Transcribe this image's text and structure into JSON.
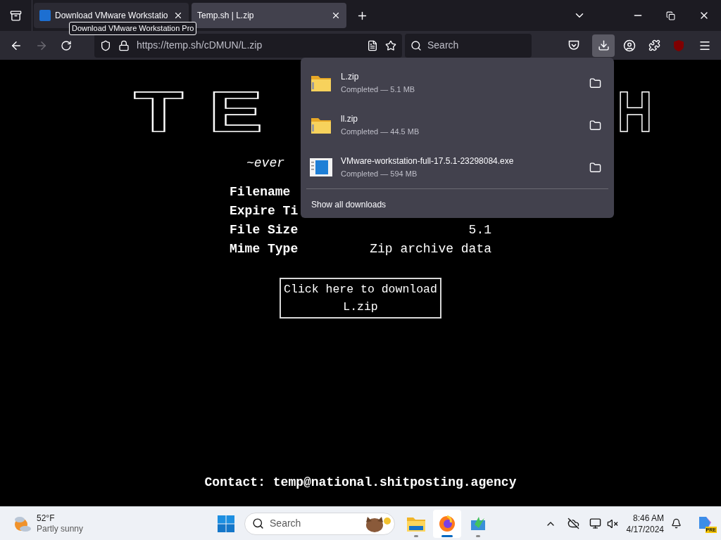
{
  "tabs": [
    {
      "title": "Download VMware Workstatio",
      "selected": false,
      "kind": "favicon"
    },
    {
      "title": "Temp.sh | L.zip",
      "selected": true,
      "kind": "plain"
    }
  ],
  "tooltip": "Download VMware Workstation Pro",
  "toolbar": {
    "url": "https://temp.sh/cDMUN/L.zip",
    "search_placeholder": "Search",
    "forward_disabled": true,
    "downloads_active": true
  },
  "page": {
    "logo_left": "TE",
    "logo_right": "H",
    "tagline": "~ever",
    "info_rows": [
      {
        "label": "Filename"
      },
      {
        "label": "Expire Ti"
      },
      {
        "label": "File Size",
        "value": "5.1"
      },
      {
        "label": "Mime Type",
        "value": "Zip archive data"
      }
    ],
    "download_button": "Click here to download L.zip",
    "contact": "Contact: temp@national.shitposting.agency"
  },
  "downloads_panel": {
    "items": [
      {
        "name": "L.zip",
        "status": "Completed — 5.1 MB",
        "kind": "zip"
      },
      {
        "name": "ll.zip",
        "status": "Completed — 44.5 MB",
        "kind": "zip"
      },
      {
        "name": "VMware-workstation-full-17.5.1-23298084.exe",
        "status": "Completed — 594 MB",
        "kind": "exe"
      }
    ],
    "show_all": "Show all downloads"
  },
  "taskbar": {
    "weather": {
      "temp": "52°F",
      "condition": "Partly sunny"
    },
    "search_placeholder": "Search",
    "apps": [
      {
        "kind": "explorer",
        "selected": false
      },
      {
        "kind": "firefox",
        "selected": true
      },
      {
        "kind": "tool",
        "selected": false
      }
    ],
    "time": "8:46 AM",
    "date": "4/17/2024",
    "copilot_badge": "PRE"
  }
}
